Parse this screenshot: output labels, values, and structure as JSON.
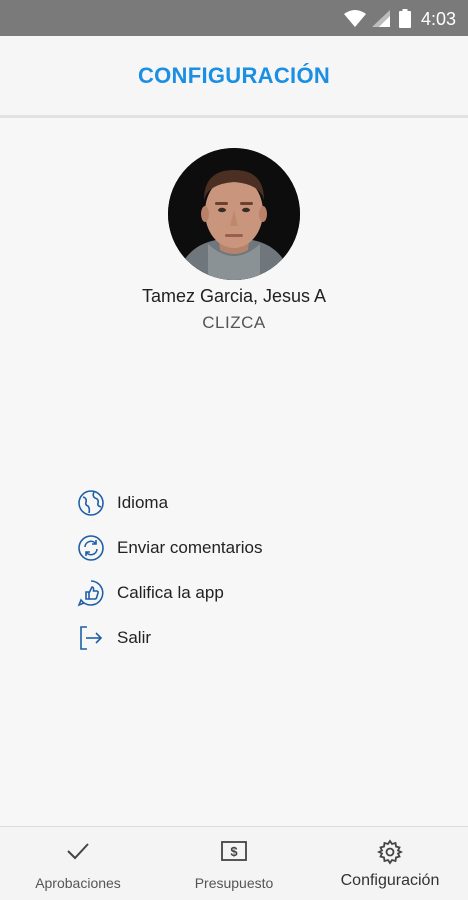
{
  "status_bar": {
    "time": "4:03"
  },
  "app_bar": {
    "title": "CONFIGURACIÓN"
  },
  "profile": {
    "name": "Tamez Garcia, Jesus A",
    "company": "CLIZCA"
  },
  "menu": {
    "items": [
      {
        "label": "Idioma",
        "icon": "globe-icon"
      },
      {
        "label": "Enviar comentarios",
        "icon": "refresh-icon"
      },
      {
        "label": "Califica la app",
        "icon": "thumbs-up-icon"
      },
      {
        "label": "Salir",
        "icon": "logout-icon"
      }
    ]
  },
  "bottom_nav": {
    "items": [
      {
        "label": "Aprobaciones",
        "icon": "checkmark-icon"
      },
      {
        "label": "Presupuesto",
        "icon": "budget-icon"
      },
      {
        "label": "Configuración",
        "icon": "gear-icon",
        "active": true
      }
    ]
  },
  "colors": {
    "accent": "#1a8fe3",
    "icon_blue": "#1f5fa8",
    "status_bar": "#7a7a7a"
  }
}
